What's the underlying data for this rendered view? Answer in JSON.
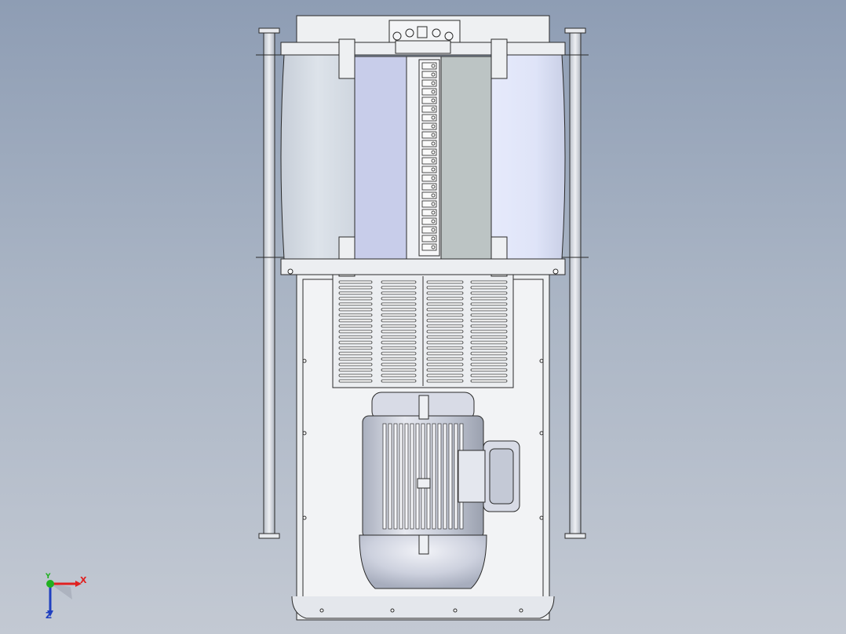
{
  "viewport": {
    "background_top": "#8e9db4",
    "background_bottom": "#c3c9d3",
    "line_color": "#2a2a2a"
  },
  "model": {
    "panel_left_color": "#d6dde6",
    "panel_right_color": "#dde3f5",
    "door_left_color": "#c8cdea",
    "door_right_color": "#bcc4c4",
    "frame_color": "#eef0f2",
    "motor_body_color": "#c4c9d6",
    "motor_end_color": "#d8dbe6"
  },
  "triad": {
    "x_label": "X",
    "y_label": "Y",
    "z_label": "Z",
    "x_color": "#e02020",
    "y_color": "#20b020",
    "z_color": "#2040c0"
  }
}
